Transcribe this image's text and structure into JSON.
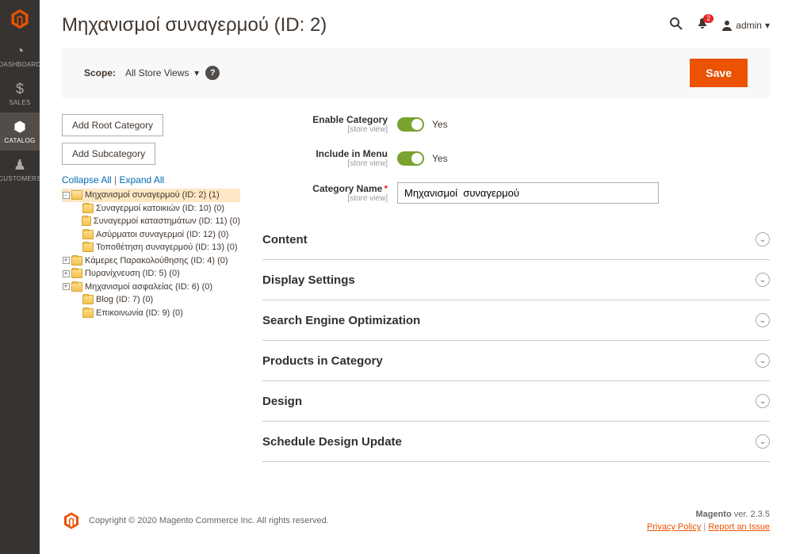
{
  "page": {
    "title": "Μηχανισμοί συναγερμού (ID: 2)"
  },
  "nav": {
    "dashboard": "Dashboard",
    "sales": "Sales",
    "catalog": "Catalog",
    "customers": "Customers"
  },
  "header": {
    "notifications_count": "2",
    "user_label": "admin"
  },
  "scope": {
    "label": "Scope:",
    "value": "All Store Views"
  },
  "actions": {
    "save": "Save"
  },
  "tree_buttons": {
    "add_root": "Add Root Category",
    "add_sub": "Add Subcategory"
  },
  "tree_links": {
    "collapse": "Collapse All",
    "expand": "Expand All"
  },
  "tree": [
    {
      "label": "Μηχανισμοί συναγερμού (ID: 2) (1)",
      "selected": true,
      "expanded": true,
      "toggle": "-",
      "indent": 0
    },
    {
      "label": "Συναγερμοί κατοικιών (ID: 10) (0)",
      "toggle": "",
      "indent": 1
    },
    {
      "label": "Συναγερμοί καταστημάτων (ID: 11) (0)",
      "toggle": "",
      "indent": 1
    },
    {
      "label": "Ασύρματοι συναγερμοί (ID: 12) (0)",
      "toggle": "",
      "indent": 1
    },
    {
      "label": "Τοποθέτηση συναγερμού (ID: 13) (0)",
      "toggle": "",
      "indent": 1
    },
    {
      "label": "Κάμερες Παρακολούθησης (ID: 4) (0)",
      "toggle": "+",
      "indent": 0
    },
    {
      "label": "Πυρανίχνευση (ID: 5) (0)",
      "toggle": "+",
      "indent": 0
    },
    {
      "label": "Μηχανισμοί ασφαλείας (ID: 6) (0)",
      "toggle": "+",
      "indent": 0
    },
    {
      "label": "Blog (ID: 7) (0)",
      "toggle": "",
      "indent": 1
    },
    {
      "label": "Επικοινωνία (ID: 9) (0)",
      "toggle": "",
      "indent": 1
    }
  ],
  "form": {
    "enable_label": "Enable Category",
    "enable_value": "Yes",
    "menu_label": "Include in Menu",
    "menu_value": "Yes",
    "name_label": "Category Name",
    "name_value": "Μηχανισμοί  συναγερμού",
    "scope_hint": "[store view]"
  },
  "sections": {
    "content": "Content",
    "display": "Display Settings",
    "seo": "Search Engine Optimization",
    "products": "Products in Category",
    "design": "Design",
    "schedule": "Schedule Design Update"
  },
  "footer": {
    "copyright": "Copyright © 2020 Magento Commerce Inc. All rights reserved.",
    "product": "Magento",
    "version": " ver. 2.3.5",
    "privacy": "Privacy Policy",
    "report": "Report an Issue"
  },
  "colors": {
    "accent": "#eb5202",
    "toggle_on": "#79a22e"
  }
}
